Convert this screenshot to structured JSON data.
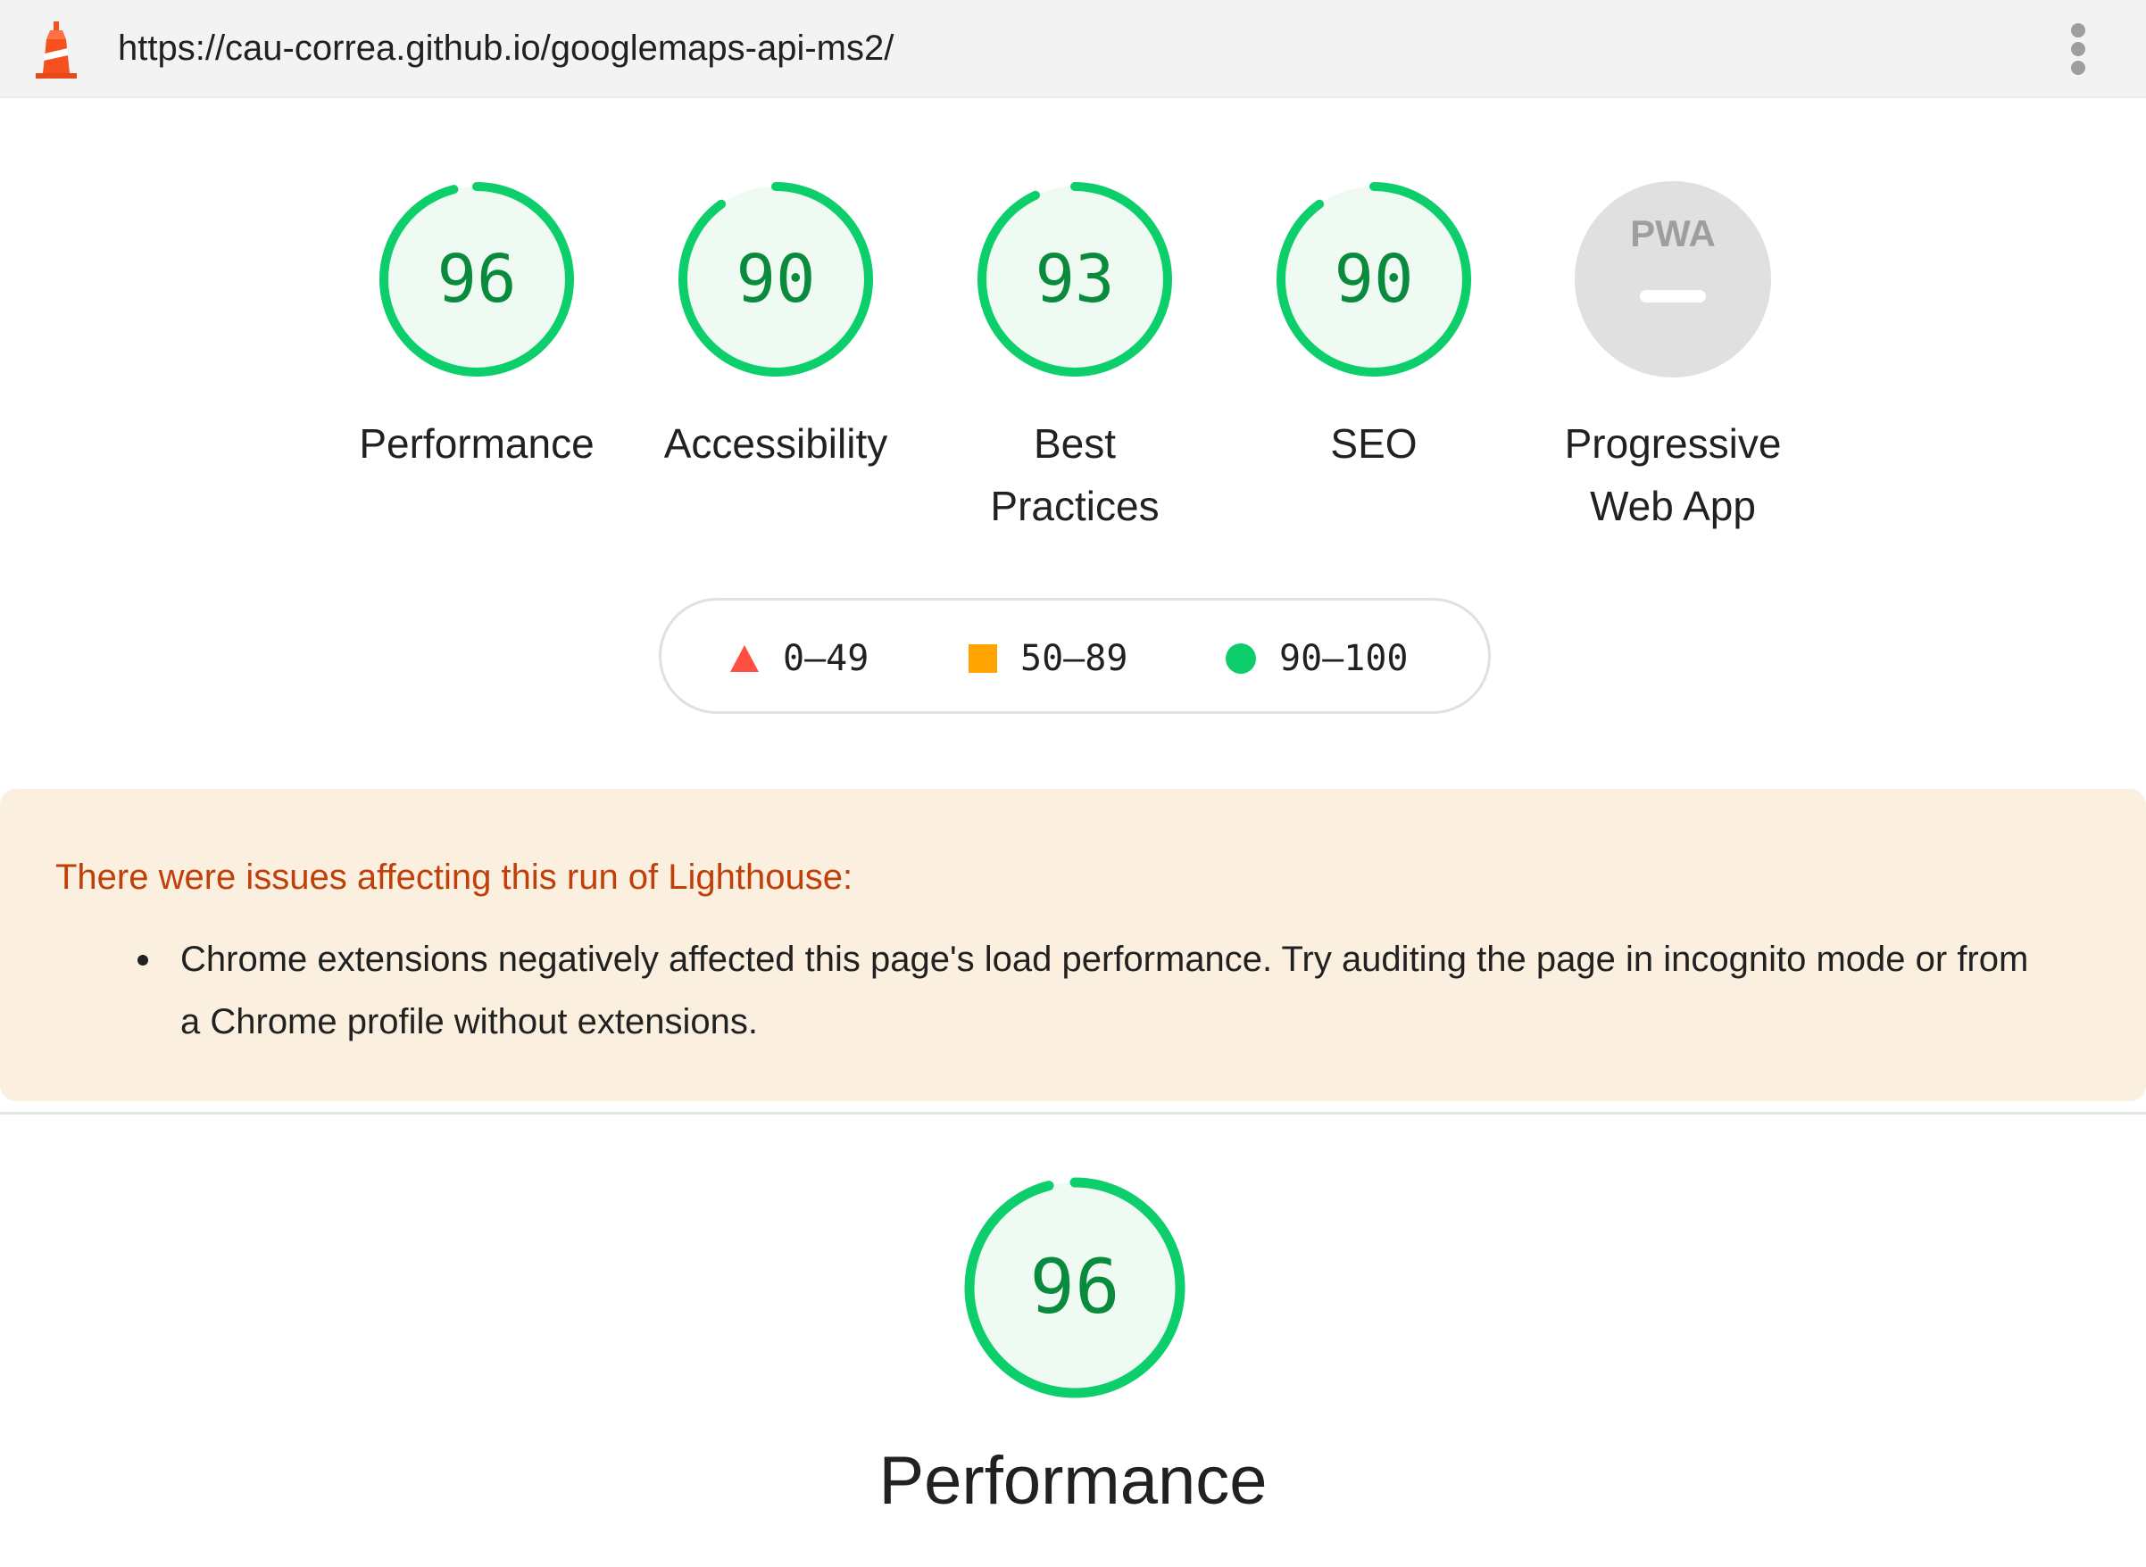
{
  "browser": {
    "url": "https://cau-correa.github.io/googlemaps-api-ms2/",
    "logo_icon": "lighthouse-icon",
    "menu_icon": "kebab-menu-icon"
  },
  "colors": {
    "pass": "#0cce6b",
    "pass_fill": "#eefaf2",
    "pass_text": "#0a8a3c",
    "average": "#ffa400",
    "fail": "#ff4e42",
    "na_fill": "#e0e0e0",
    "warning_bg": "#fbf0e0",
    "warning_text": "#c0400a"
  },
  "scores": [
    {
      "value": "96",
      "label": "Performance"
    },
    {
      "value": "90",
      "label": "Accessibility"
    },
    {
      "value": "93",
      "label": "Best Practices"
    },
    {
      "value": "90",
      "label": "SEO"
    }
  ],
  "score_fractions": [
    0.96,
    0.9,
    0.93,
    0.9
  ],
  "pwa": {
    "badge": "PWA",
    "label": "Progressive Web App"
  },
  "legend": [
    {
      "range": "0–49",
      "icon": "triangle-icon"
    },
    {
      "range": "50–89",
      "icon": "square-icon"
    },
    {
      "range": "90–100",
      "icon": "circle-icon"
    }
  ],
  "warning": {
    "title": "There were issues affecting this run of Lighthouse:",
    "items": [
      "Chrome extensions negatively affected this page's load performance. Try auditing the page in incognito mode or from a Chrome profile without extensions."
    ]
  },
  "section": {
    "score": "96",
    "score_fraction": 0.96,
    "title": "Performance"
  }
}
